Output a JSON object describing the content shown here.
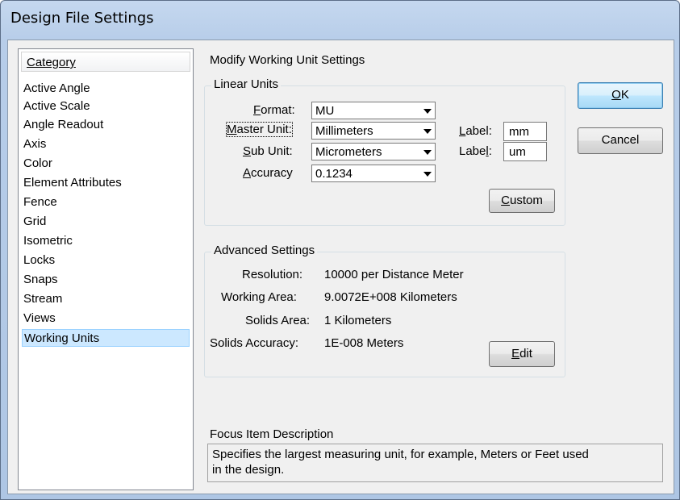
{
  "window": {
    "title": "Design File Settings"
  },
  "category": {
    "header": "Category",
    "items": [
      "Active Angle",
      "Active Scale",
      "Angle Readout",
      "Axis",
      "Color",
      "Element Attributes",
      "Fence",
      "Grid",
      "Isometric",
      "Locks",
      "Snaps",
      "Stream",
      "Views",
      "Working Units"
    ],
    "selected": "Working Units"
  },
  "main": {
    "heading": "Modify Working Unit Settings"
  },
  "linear_units": {
    "legend": "Linear Units",
    "format": {
      "label_pre": "",
      "label_u": "F",
      "label_post": "ormat:",
      "value": "MU"
    },
    "master_unit": {
      "label_pre": "",
      "label_u": "M",
      "label_post": "aster Unit:",
      "value": "Millimeters"
    },
    "sub_unit": {
      "label_pre": "",
      "label_u": "S",
      "label_post": "ub Unit:",
      "value": "Micrometers"
    },
    "accuracy": {
      "label_pre": "",
      "label_u": "A",
      "label_post": "ccuracy",
      "value": "0.1234"
    },
    "master_label": {
      "label_pre": "",
      "label_u": "L",
      "label_post": "abel:",
      "value": "mm"
    },
    "sub_label": {
      "label_pre": "Labe",
      "label_u": "l",
      "label_post": ":",
      "value": "um"
    },
    "custom_button": {
      "pre": "",
      "u": "C",
      "post": "ustom"
    }
  },
  "advanced": {
    "legend": "Advanced Settings",
    "rows": [
      {
        "label": "Resolution:",
        "value": "10000 per Distance Meter"
      },
      {
        "label": "Working Area:",
        "value": "9.0072E+008 Kilometers"
      },
      {
        "label": "Solids Area:",
        "value": "1 Kilometers"
      },
      {
        "label": "Solids Accuracy:",
        "value": "1E-008 Meters"
      }
    ],
    "edit_button": {
      "pre": "",
      "u": "E",
      "post": "dit"
    }
  },
  "buttons": {
    "ok": {
      "pre": "",
      "u": "O",
      "post": "K"
    },
    "cancel": "Cancel"
  },
  "focus": {
    "title": "Focus Item Description",
    "text_line1": "Specifies the largest measuring unit, for example, Meters or Feet used",
    "text_line2": "in the design."
  },
  "colors": {
    "selection": "#cce8ff",
    "titlebar": "#b9d1ea",
    "dialog_bg": "#f0f0f0"
  }
}
